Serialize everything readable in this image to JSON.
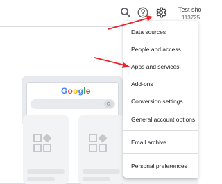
{
  "header": {
    "search_icon": "search-icon",
    "help_icon": "help-icon",
    "settings_icon": "gear-icon",
    "account_name": "Test sho",
    "account_id": "113725"
  },
  "background": {
    "logo_letters": [
      "G",
      "o",
      "o",
      "g",
      "l",
      "e"
    ]
  },
  "menu": {
    "items": [
      {
        "label": "Data sources"
      },
      {
        "label": "People and access"
      },
      {
        "label": "Apps and services"
      },
      {
        "label": "Add-ons"
      },
      {
        "label": "Conversion settings"
      },
      {
        "label": "General account options"
      },
      {
        "label": "Email archive"
      },
      {
        "label": "Personal preferences"
      }
    ]
  },
  "colors": {
    "annotation_arrow": "#e8232a",
    "google_blue": "#4285F4",
    "google_red": "#EA4335",
    "google_yellow": "#FBBC05",
    "google_green": "#34A853"
  }
}
